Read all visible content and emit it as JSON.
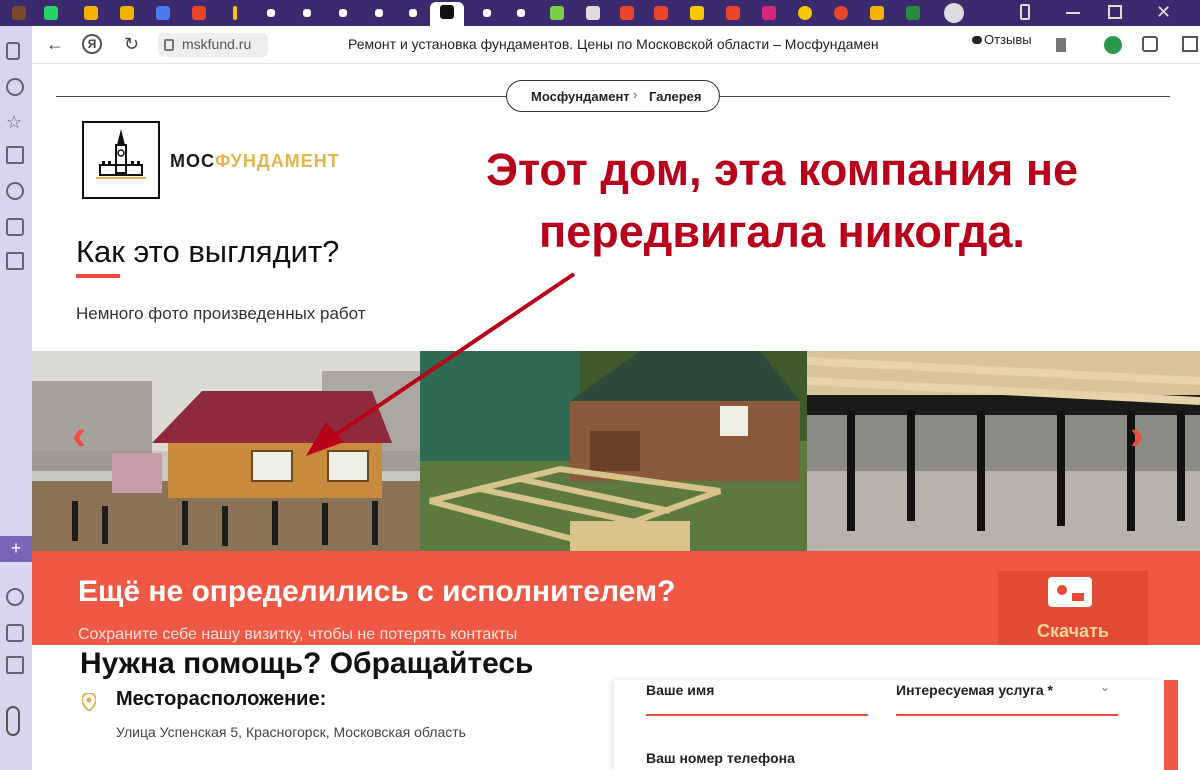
{
  "browser": {
    "url": "mskfund.ru",
    "page_title": "Ремонт и установка фундаментов. Цены по Московской области – Мосфундамен",
    "reviews_label": "Отзывы"
  },
  "breadcrumb": {
    "home": "Мосфундамент",
    "current": "Галерея"
  },
  "brand": {
    "part1": "МОС",
    "part2": "ФУНДАМЕНТ",
    "color1": "#1a1a1a",
    "color2": "#e0b64a"
  },
  "callout": {
    "line1": "Этот дом,  эта компания не",
    "line2": "передвигала никогда.",
    "color": "#b8001a"
  },
  "gallery_section": {
    "title": "Как это выглядит?",
    "subtitle": "Немного фото произведенных работ"
  },
  "cta": {
    "title": "Ещё не определились с исполнителем?",
    "subtitle": "Сохраните себе нашу визитку, чтобы не потерять контакты",
    "download_label": "Скачать"
  },
  "contact": {
    "title": "Нужна помощь? Обращайтесь",
    "location_label": "Месторасположение:",
    "location_value": "Улица Успенская 5, Красногорск, Московская область"
  },
  "form": {
    "name_label": "Ваше имя",
    "service_label": "Интересуемая услуга *",
    "phone_label": "Ваш номер телефона"
  },
  "colors": {
    "accent": "#ef5844",
    "tabbar": "#3b2a6e"
  }
}
